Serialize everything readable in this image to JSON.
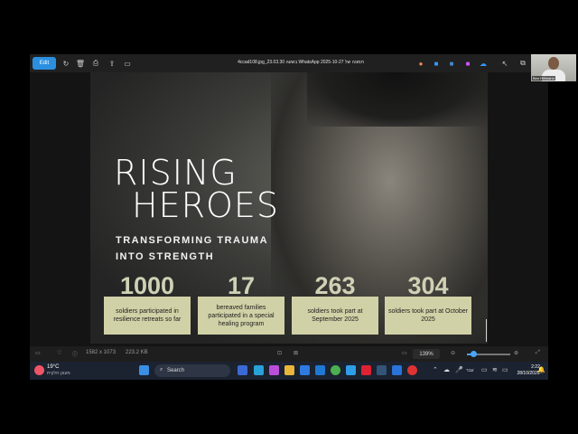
{
  "window": {
    "edit_label": "Edit",
    "title": "4ccad108.jpg_23.03.30 בשעה WhatsApp 2025-10-27 תמונה של"
  },
  "poster": {
    "title_line1": "RISING",
    "title_line2": "HEROES",
    "subtitle_line1": "TRANSFORMING TRAUMA",
    "subtitle_line2": "INTO STRENGTH",
    "stats": [
      {
        "number": "1000",
        "caption": "soldiers participated in resilience retreats so far"
      },
      {
        "number": "17",
        "caption": "bereaved families participated in a special healing program"
      },
      {
        "number": "263",
        "caption": "soldiers took part at September 2025"
      },
      {
        "number": "304",
        "caption": "soldiers took part at October 2025"
      }
    ],
    "colors": {
      "stat_box": "#d1d1a7",
      "stat_number": "#cfd1b5"
    }
  },
  "statusbar": {
    "dimensions": "1582 x 1073",
    "file_size": "223.2 KB",
    "zoom": "139%"
  },
  "taskbar": {
    "weather_temp": "19°C",
    "weather_desc": "מעונן חלקית",
    "search_label": "Search",
    "language": "עבר",
    "time": "2:22",
    "date": "28/10/2025"
  },
  "webcam": {
    "name_label": "Ben Hillmann"
  },
  "icons": {
    "toolbar": [
      "rotate-icon",
      "delete-icon",
      "print-icon",
      "share-icon",
      "slideshow-icon"
    ],
    "toolbar_right": [
      "app-icon-1",
      "app-icon-2",
      "app-icon-3",
      "app-icon-4",
      "cloud-icon",
      "more-icon"
    ]
  }
}
